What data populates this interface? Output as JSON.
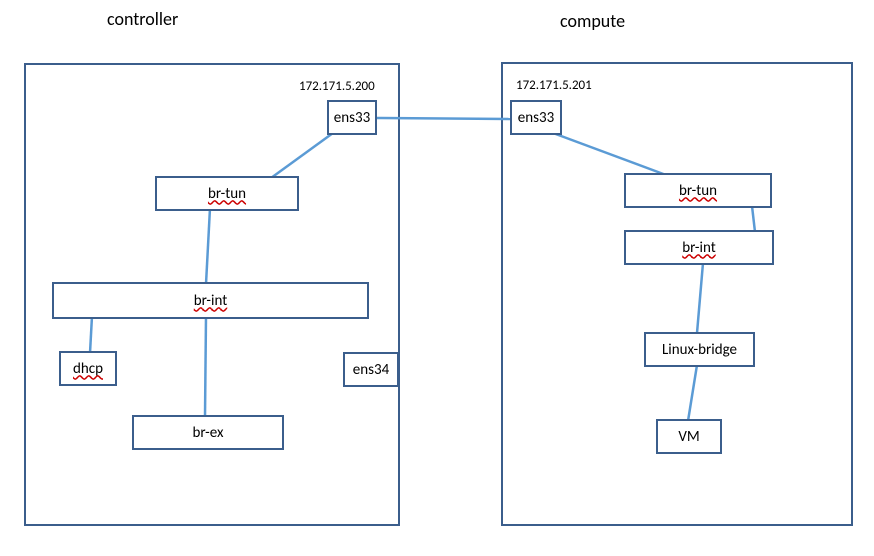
{
  "titles": {
    "controller": "controller",
    "compute": "compute"
  },
  "ips": {
    "controller_ens33": "172.171.5.200",
    "compute_ens33": "172.171.5.201"
  },
  "nodes": {
    "ctrl_ens33": "ens33",
    "ctrl_brtun": "br-tun",
    "ctrl_brint": "br-int",
    "ctrl_dhcp": "dhcp",
    "ctrl_ens34": "ens34",
    "ctrl_brex": "br-ex",
    "comp_ens33": "ens33",
    "comp_brtun": "br-tun",
    "comp_brint": "br-int",
    "comp_linuxbridge": "Linux-bridge",
    "comp_vm": "VM"
  }
}
